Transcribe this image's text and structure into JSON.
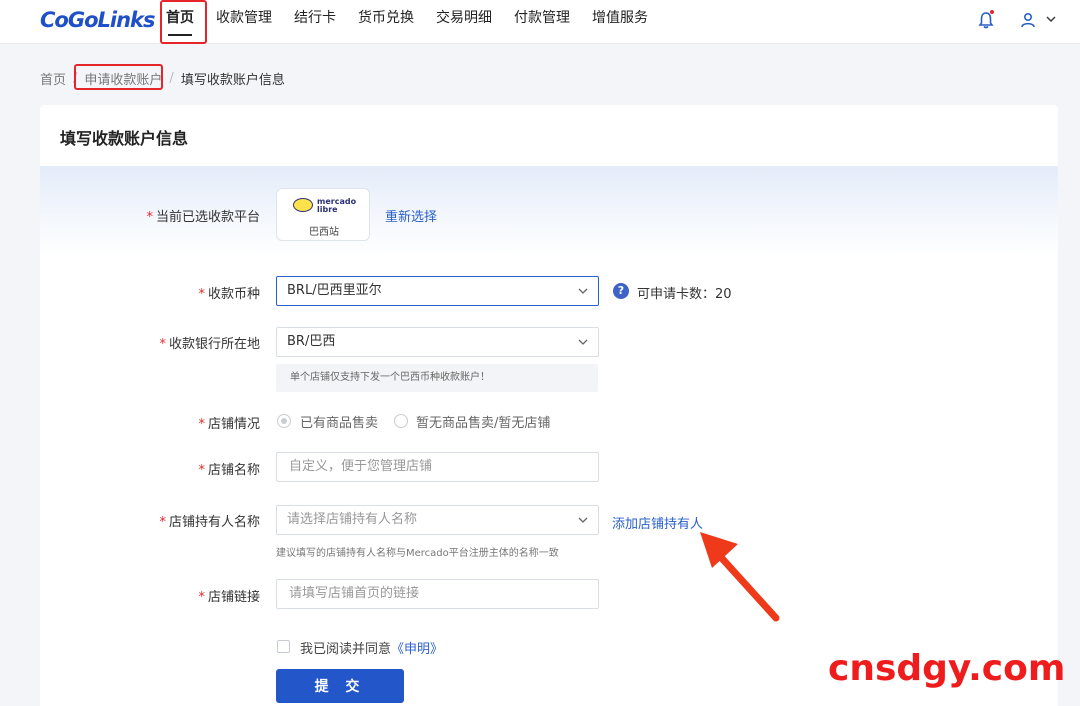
{
  "brand": {
    "logo_text": "CoGoLinks"
  },
  "nav": {
    "items": [
      {
        "label": "首页",
        "active": true
      },
      {
        "label": "收款管理"
      },
      {
        "label": "结行卡"
      },
      {
        "label": "货币兑换"
      },
      {
        "label": "交易明细"
      },
      {
        "label": "付款管理"
      },
      {
        "label": "增值服务"
      }
    ]
  },
  "breadcrumb": {
    "home": "首页",
    "apply": "申请收款账户",
    "current": "填写收款账户信息",
    "separator": "/"
  },
  "form": {
    "title": "填写收款账户信息",
    "required_mark": "*",
    "platform": {
      "label": "当前已选收款平台",
      "logo_line1": "mercado",
      "logo_line2": "libre",
      "site": "巴西站",
      "reselect": "重新选择"
    },
    "currency": {
      "label": "收款币种",
      "value": "BRL/巴西里亚尔",
      "card_count": "可申请卡数：20"
    },
    "bank_location": {
      "label": "收款银行所在地",
      "value": "BR/巴西",
      "tip": "单个店铺仅支持下发一个巴西币种收款账户！"
    },
    "shop_status": {
      "label": "店铺情况",
      "options": [
        "已有商品售卖",
        "暂无商品售卖/暂无店铺"
      ],
      "selected": 0
    },
    "shop_name": {
      "label": "店铺名称",
      "placeholder": "自定义，便于您管理店铺"
    },
    "shop_owner": {
      "label": "店铺持有人名称",
      "placeholder": "请选择店铺持有人名称",
      "add_link": "添加店铺持有人",
      "hint": "建议填写的店铺持有人名称与Mercado平台注册主体的名称一致"
    },
    "shop_link": {
      "label": "店铺链接",
      "placeholder": "请填写店铺首页的链接"
    },
    "agreement": {
      "text": "我已阅读并同意",
      "link": "《申明》"
    },
    "submit": "提 交"
  },
  "watermark": "cnsdgy.com",
  "colors": {
    "primary": "#2256c9",
    "link": "#2a5fc9",
    "highlight": "#e5252a",
    "watermark": "#ee1c1c"
  }
}
